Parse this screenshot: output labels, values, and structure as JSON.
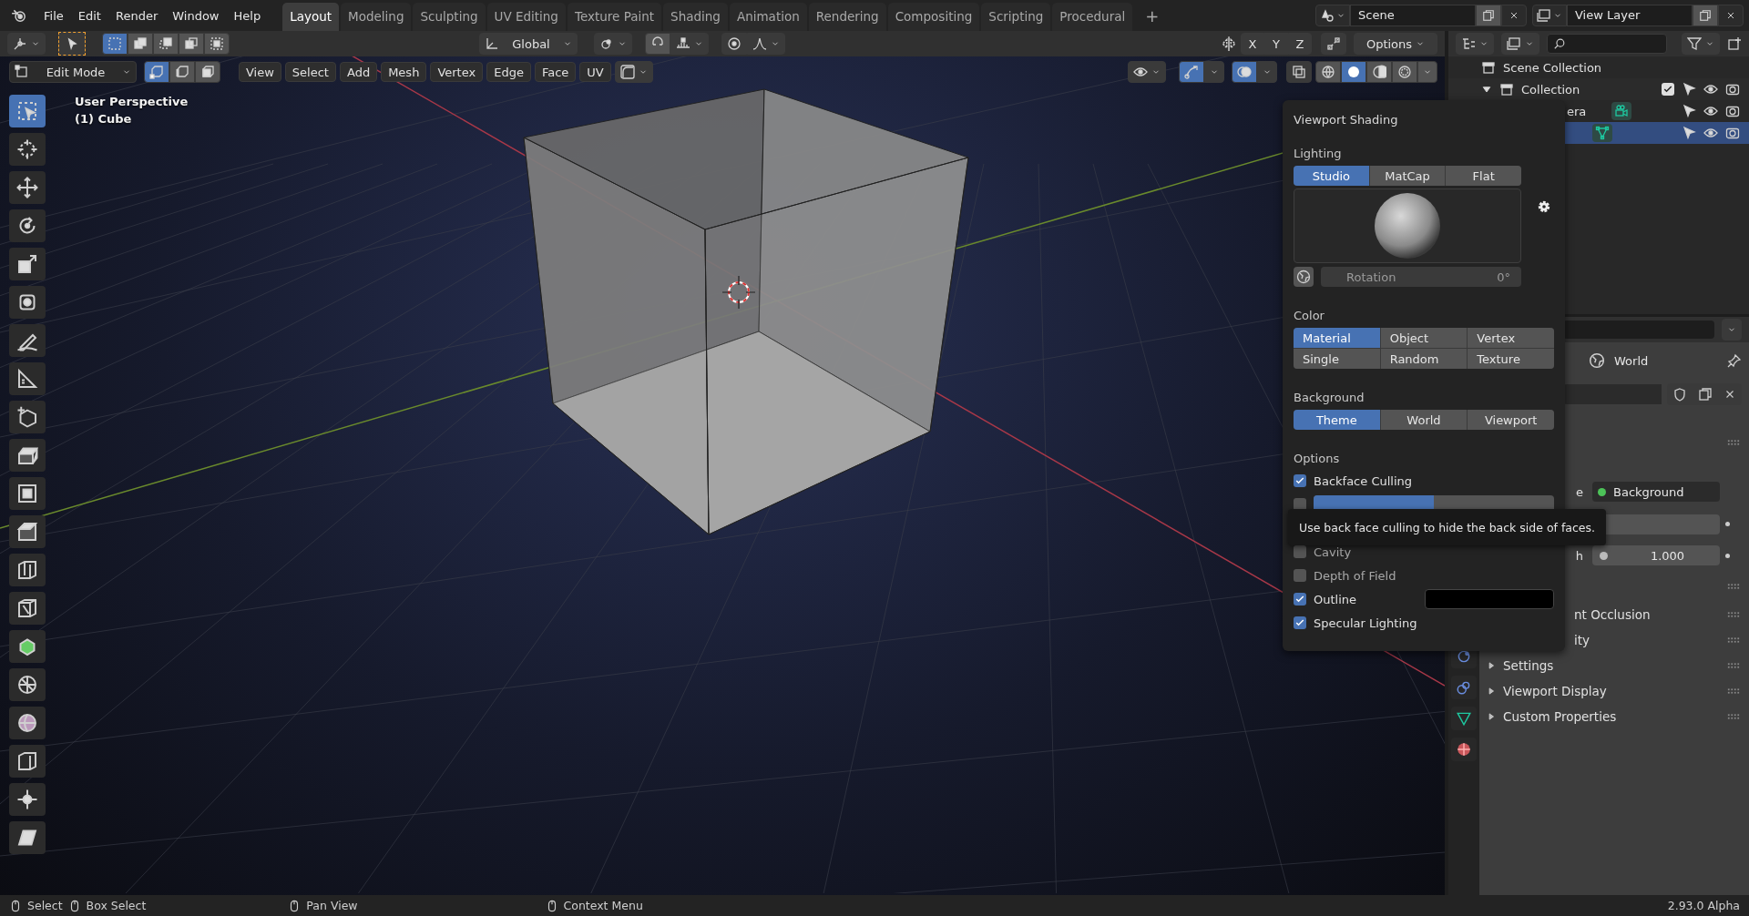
{
  "menu": [
    "File",
    "Edit",
    "Render",
    "Window",
    "Help"
  ],
  "workspaces": [
    {
      "label": "Layout",
      "selected": true
    },
    {
      "label": "Modeling",
      "selected": false
    },
    {
      "label": "Sculpting",
      "selected": false
    },
    {
      "label": "UV Editing",
      "selected": false
    },
    {
      "label": "Texture Paint",
      "selected": false
    },
    {
      "label": "Shading",
      "selected": false
    },
    {
      "label": "Animation",
      "selected": false
    },
    {
      "label": "Rendering",
      "selected": false
    },
    {
      "label": "Compositing",
      "selected": false
    },
    {
      "label": "Scripting",
      "selected": false
    },
    {
      "label": "Procedural",
      "selected": false
    }
  ],
  "add_workspace": "+",
  "scene": {
    "name": "Scene"
  },
  "view_layer": {
    "name": "View Layer"
  },
  "tool_header": {
    "select_modes": [
      {
        "selected": true
      },
      {
        "selected": false
      },
      {
        "selected": false
      },
      {
        "selected": false
      },
      {
        "selected": false
      }
    ],
    "orientation": "Global",
    "axes": [
      "X",
      "Y",
      "Z"
    ],
    "options": "Options"
  },
  "viewport_header": {
    "mode": "Edit Mode",
    "element_modes": [
      {
        "selected": true
      },
      {
        "selected": false
      },
      {
        "selected": false
      }
    ],
    "menus": [
      "View",
      "Select",
      "Add",
      "Mesh",
      "Vertex",
      "Edge",
      "Face",
      "UV"
    ],
    "shading_modes": [
      {
        "selected": false
      },
      {
        "selected": true
      },
      {
        "selected": false
      },
      {
        "selected": false
      }
    ]
  },
  "viewport": {
    "title": "User Perspective",
    "object": "(1) Cube"
  },
  "toolbar": [
    {
      "selected": true
    },
    {
      "selected": false
    },
    {
      "selected": false
    },
    {
      "selected": false
    },
    {
      "selected": false
    },
    {
      "selected": false
    },
    {
      "selected": false
    },
    {
      "selected": false
    },
    {
      "selected": false
    },
    {
      "selected": false
    },
    {
      "selected": false
    },
    {
      "selected": false
    },
    {
      "selected": false
    },
    {
      "selected": false
    },
    {
      "selected": false
    },
    {
      "selected": false
    },
    {
      "selected": false
    },
    {
      "selected": false
    },
    {
      "selected": false
    },
    {
      "selected": false
    }
  ],
  "shading_popover": {
    "title": "Viewport Shading",
    "lighting": {
      "label": "Lighting",
      "options": [
        {
          "label": "Studio",
          "selected": true
        },
        {
          "label": "MatCap",
          "selected": false
        },
        {
          "label": "Flat",
          "selected": false
        }
      ]
    },
    "rotation": {
      "label": "Rotation",
      "value": "0°"
    },
    "color": {
      "label": "Color",
      "options": [
        {
          "label": "Material",
          "selected": true
        },
        {
          "label": "Object",
          "selected": false
        },
        {
          "label": "Vertex",
          "selected": false
        },
        {
          "label": "Single",
          "selected": false
        },
        {
          "label": "Random",
          "selected": false
        },
        {
          "label": "Texture",
          "selected": false
        }
      ]
    },
    "background": {
      "label": "Background",
      "options": [
        {
          "label": "Theme",
          "selected": true
        },
        {
          "label": "World",
          "selected": false
        },
        {
          "label": "Viewport",
          "selected": false
        }
      ]
    },
    "options": {
      "label": "Options",
      "items": [
        {
          "kind": "check",
          "label": "Backface Culling",
          "checked": true
        },
        {
          "kind": "slider",
          "checked": false,
          "level": 0.5
        },
        {
          "kind": "hidden"
        },
        {
          "kind": "check",
          "label": "Cavity",
          "checked": false
        },
        {
          "kind": "check",
          "label": "Depth of Field",
          "checked": false
        },
        {
          "kind": "color",
          "label": "Outline",
          "checked": true,
          "color": "#000000"
        },
        {
          "kind": "check",
          "label": "Specular Lighting",
          "checked": true
        }
      ]
    }
  },
  "tooltip": "Use back face culling to hide the back side of faces.",
  "outliner": {
    "items": [
      {
        "kind": "scene",
        "label": "Scene Collection"
      },
      {
        "kind": "collection",
        "label": "Collection",
        "checked": true,
        "selected": false
      },
      {
        "kind": "camera",
        "label": "era",
        "selected": false
      },
      {
        "kind": "mesh",
        "selected": true
      }
    ]
  },
  "properties": {
    "tabs": [
      {
        "selected": false
      },
      {
        "selected": false
      },
      {
        "selected": false
      },
      {
        "selected": false
      }
    ],
    "world": {
      "name": "World"
    },
    "surface": {
      "label": "e",
      "value": "Background"
    },
    "strength": {
      "label": "h",
      "value": "1.000"
    },
    "panels": [
      {
        "kind": "clipped",
        "label": "nt Occlusion"
      },
      {
        "kind": "clipped",
        "label": "ity"
      },
      {
        "kind": "panel",
        "label": "Settings",
        "expanded": false
      },
      {
        "kind": "panel",
        "label": "Viewport Display",
        "expanded": false
      },
      {
        "kind": "panel",
        "label": "Custom Properties",
        "expanded": false
      }
    ]
  },
  "status_bar": {
    "hints": [
      "Select",
      "Box Select",
      "Pan View",
      "Context Menu"
    ],
    "version": "2.93.0 Alpha"
  }
}
